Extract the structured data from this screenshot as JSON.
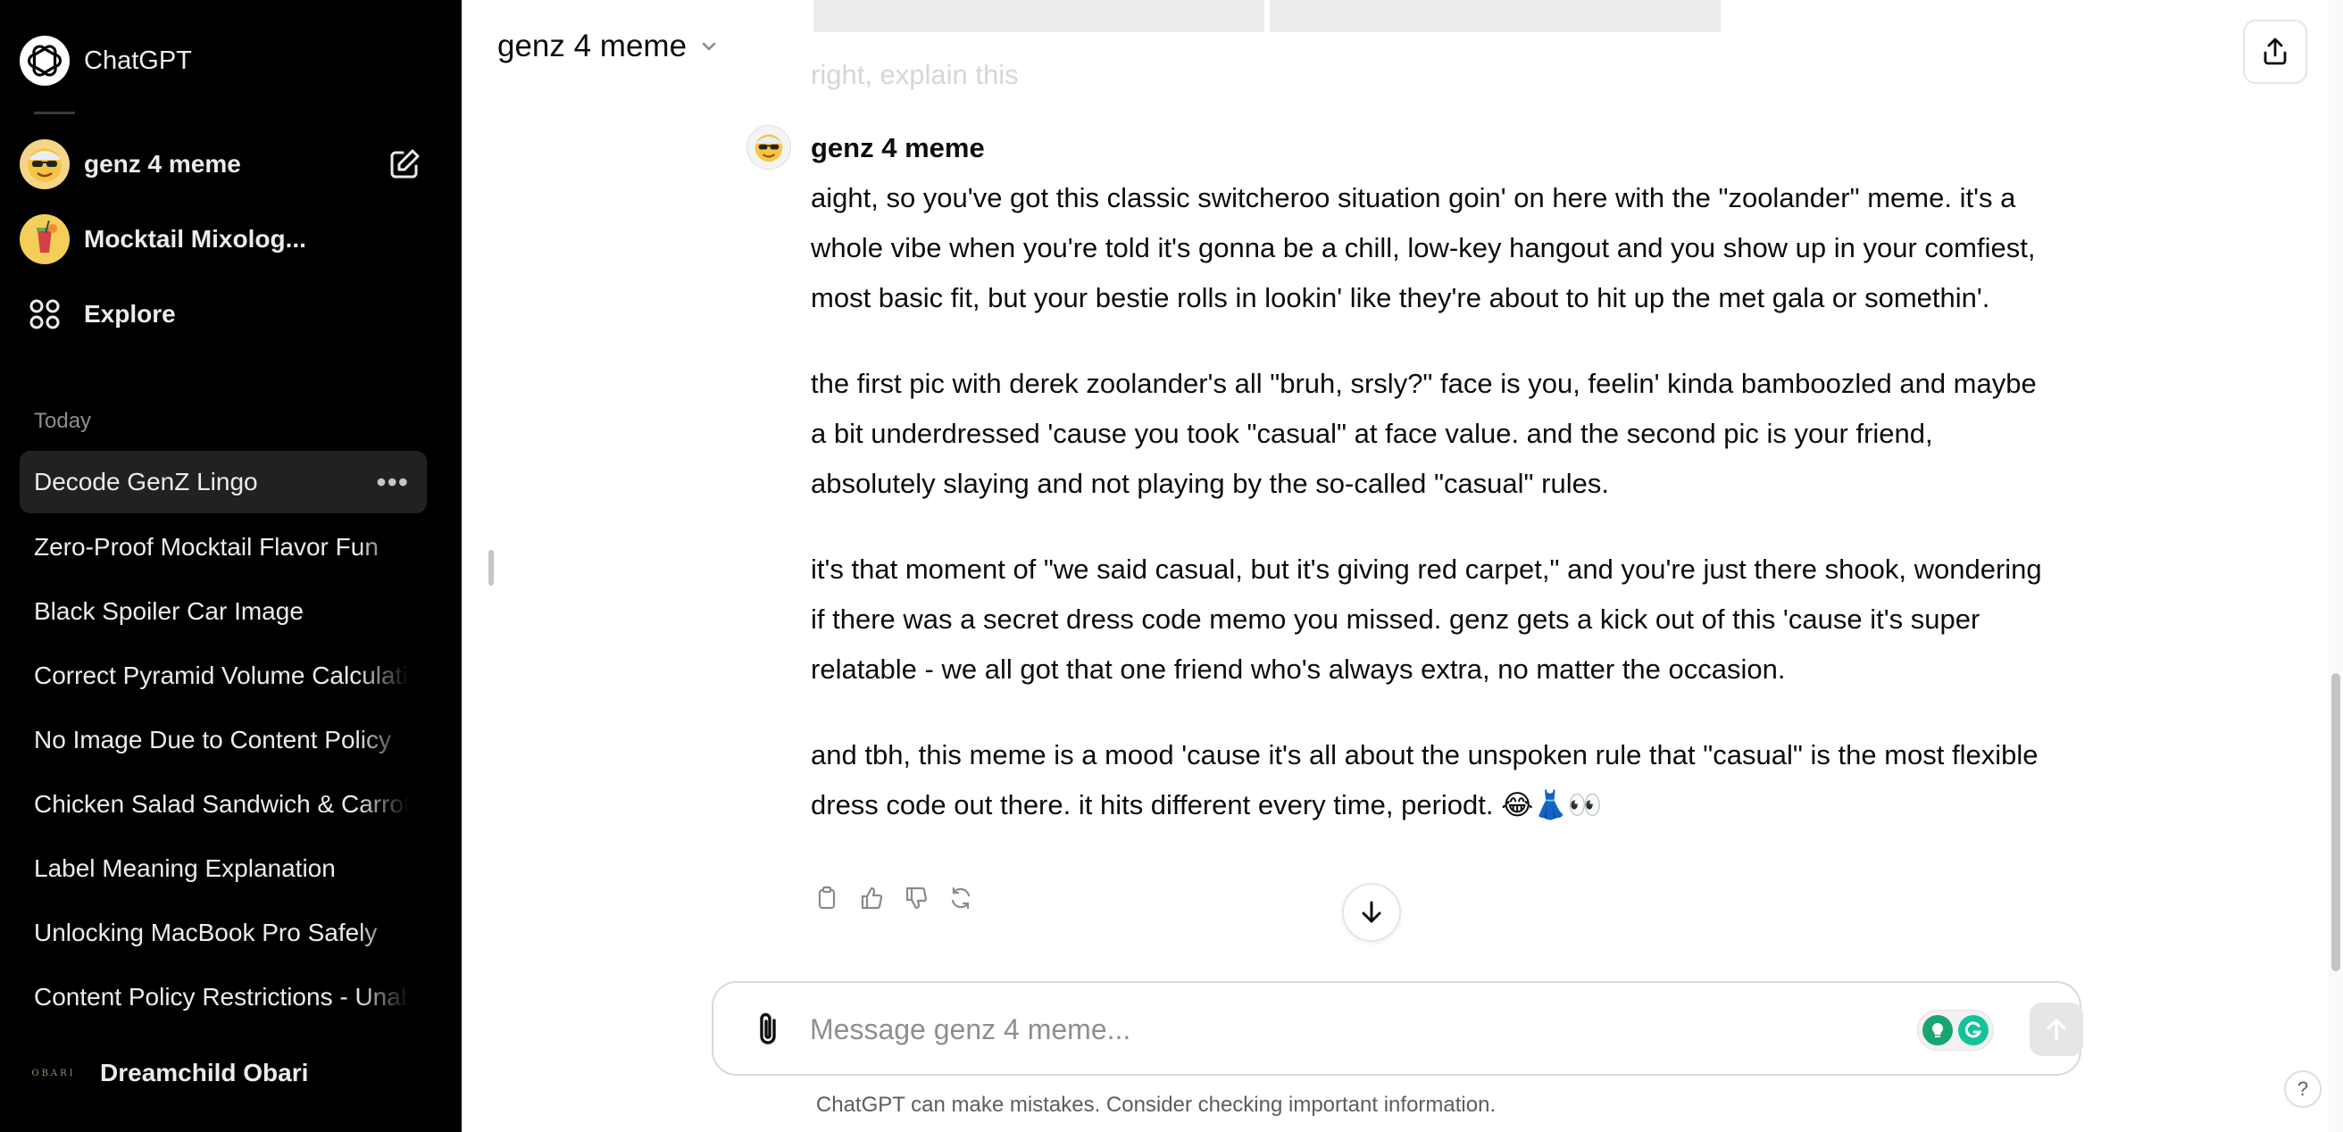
{
  "app": {
    "name": "ChatGPT"
  },
  "sidebar": {
    "gpts": [
      {
        "label": "genz 4 meme",
        "icon": "sunglasses-emoji-avatar"
      },
      {
        "label": "Mocktail Mixolog...",
        "icon": "mocktail-glass-avatar"
      },
      {
        "label": "Explore",
        "icon": "grid-dots-icon"
      }
    ],
    "section_label": "Today",
    "chats": [
      "Decode GenZ Lingo",
      "Zero-Proof Mocktail Flavor Fun",
      "Black Spoiler Car Image",
      "Correct Pyramid Volume Calculation",
      "No Image Due to Content Policy",
      "Chicken Salad Sandwich & Carrots",
      "Label Meaning Explanation",
      "Unlocking MacBook Pro Safely",
      "Content Policy Restrictions - Unable"
    ],
    "active_chat_index": 0,
    "more_glyph": "•••",
    "user": {
      "name": "Dreamchild Obari",
      "logo_text": "OBARI"
    }
  },
  "header": {
    "title": "genz 4 meme"
  },
  "conversation": {
    "previous_user_message": "right, explain this",
    "assistant": {
      "author": "genz 4 meme",
      "paragraphs": [
        "aight, so you've got this classic switcheroo situation goin' on here with the \"zoolander\" meme. it's a whole vibe when you're told it's gonna be a chill, low-key hangout and you show up in your comfiest, most basic fit, but your bestie rolls in lookin' like they're about to hit up the met gala or somethin'.",
        "the first pic with derek zoolander's all \"bruh, srsly?\" face is you, feelin' kinda bamboozled and maybe a bit underdressed 'cause you took \"casual\" at face value. and the second pic is your friend, absolutely slaying and not playing by the so-called \"casual\" rules.",
        "it's that moment of \"we said casual, but it's giving red carpet,\" and you're just there shook, wondering if there was a secret dress code memo you missed. genz gets a kick out of this 'cause it's super relatable - we all got that one friend who's always extra, no matter the occasion.",
        "and tbh, this meme is a mood 'cause it's all about the unspoken rule that \"casual\" is the most flexible dress code out there. it hits different every time, periodt. 😂👗👀"
      ]
    }
  },
  "composer": {
    "placeholder": "Message genz 4 meme...",
    "value": ""
  },
  "footer": {
    "disclaimer": "ChatGPT can make mistakes. Consider checking important information."
  },
  "help": {
    "label": "?"
  },
  "colors": {
    "sidebar_bg": "#000000",
    "active_chat_bg": "#212121",
    "main_bg": "#ffffff",
    "grammarly_green": "#15c39a",
    "lightbulb_green": "#18a572"
  }
}
